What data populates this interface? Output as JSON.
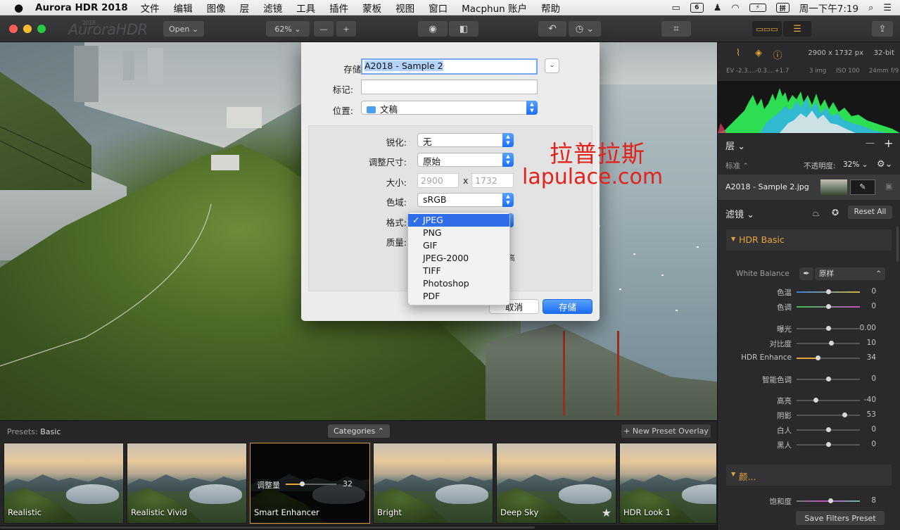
{
  "menubar": {
    "app": "Aurora HDR 2018",
    "menus": [
      "文件",
      "编辑",
      "图像",
      "层",
      "滤镜",
      "工具",
      "插件",
      "蒙板",
      "视图",
      "窗口",
      "Macphun 账户",
      "帮助"
    ],
    "cal_day": "6",
    "clock": "周一下午7:19"
  },
  "toolbar": {
    "logo": "AuroraHDR",
    "logo_year": "2018",
    "open_label": "Open ⌄",
    "zoom": "62%  ⌄",
    "minus": "—",
    "plus": "+"
  },
  "dialog": {
    "save_as_label": "存储为:",
    "save_as_value": "A2018 - Sample 2",
    "tags_label": "标记:",
    "location_label": "位置:",
    "location_value": "文稿",
    "sharpen_label": "锐化:",
    "sharpen_value": "无",
    "resize_label": "调整尺寸:",
    "resize_value": "原始",
    "size_label": "大小:",
    "width_placeholder": "2900",
    "height_placeholder": "1732",
    "size_x": "x",
    "colorspace_label": "色域:",
    "colorspace_value": "sRGB",
    "format_label": "格式:",
    "quality_label": "质量:",
    "quality_high_fragment": "高",
    "cancel": "取消",
    "save": "存储"
  },
  "format_menu": {
    "check": "✓",
    "items": [
      "JPEG",
      "PNG",
      "GIF",
      "JPEG-2000",
      "TIFF",
      "Photoshop",
      "PDF"
    ]
  },
  "watermark": {
    "line1": "拉普拉斯",
    "line2": "lapulace.com"
  },
  "presets": {
    "label": "Presets:",
    "category": "Basic",
    "categories_btn": "Categories ⌃",
    "new_overlay": "+ New Preset Overlay",
    "items": [
      "Realistic",
      "Realistic Vivid",
      "Smart Enhancer",
      "Bright",
      "Deep Sky",
      "HDR Look 1"
    ],
    "selected_amount_label": "调整量",
    "selected_amount_value": "32",
    "selected_amount": 32
  },
  "right_panel": {
    "dims": "2900 x 1732 px",
    "bit": "32-bit",
    "exif": {
      "ev": "EV -2.3....-0.3....+1.7",
      "img": "3 img",
      "iso": "ISO 100",
      "focal": "24mm",
      "aperture": "f/9"
    },
    "layers_title": "层 ⌄",
    "minus": "—",
    "plus": "+",
    "blend": "标准 ⌃",
    "opacity_label": "不透明度:",
    "opacity_value": "32% ⌄",
    "layer_name": "A2018 - Sample 2.jpg",
    "filters_title": "滤镜 ⌄",
    "reset_all": "Reset All",
    "hdr_basic": "HDR Basic",
    "white_balance_label": "White Balance",
    "white_balance_value": "原样",
    "sliders": [
      {
        "name": "色温",
        "value": "0",
        "pos": 0.5,
        "color": "temp"
      },
      {
        "name": "色调",
        "value": "0",
        "pos": 0.5,
        "color": "tint"
      },
      {
        "name": "曝光",
        "value": "0.00",
        "pos": 0.5,
        "color": ""
      },
      {
        "name": "对比度",
        "value": "10",
        "pos": 0.55,
        "color": ""
      },
      {
        "name": "HDR Enhance",
        "value": "34",
        "pos": 0.34,
        "color": "orange"
      },
      {
        "name": "智能色调",
        "value": "0",
        "pos": 0.5,
        "color": ""
      },
      {
        "name": "高亮",
        "value": "-40",
        "pos": 0.3,
        "color": ""
      },
      {
        "name": "阴影",
        "value": "53",
        "pos": 0.76,
        "color": ""
      },
      {
        "name": "白人",
        "value": "0",
        "pos": 0.5,
        "color": ""
      },
      {
        "name": "黑人",
        "value": "0",
        "pos": 0.5,
        "color": ""
      }
    ],
    "color_section": "颜...",
    "saturation_label": "饱和度",
    "saturation_value": "8",
    "saturation_pos": 0.54,
    "save_filters_preset": "Save Filters Preset"
  },
  "colors": {
    "accent": "#e9a53a",
    "save_blue": "#1a6ef5",
    "watermark": "#e2221b"
  }
}
